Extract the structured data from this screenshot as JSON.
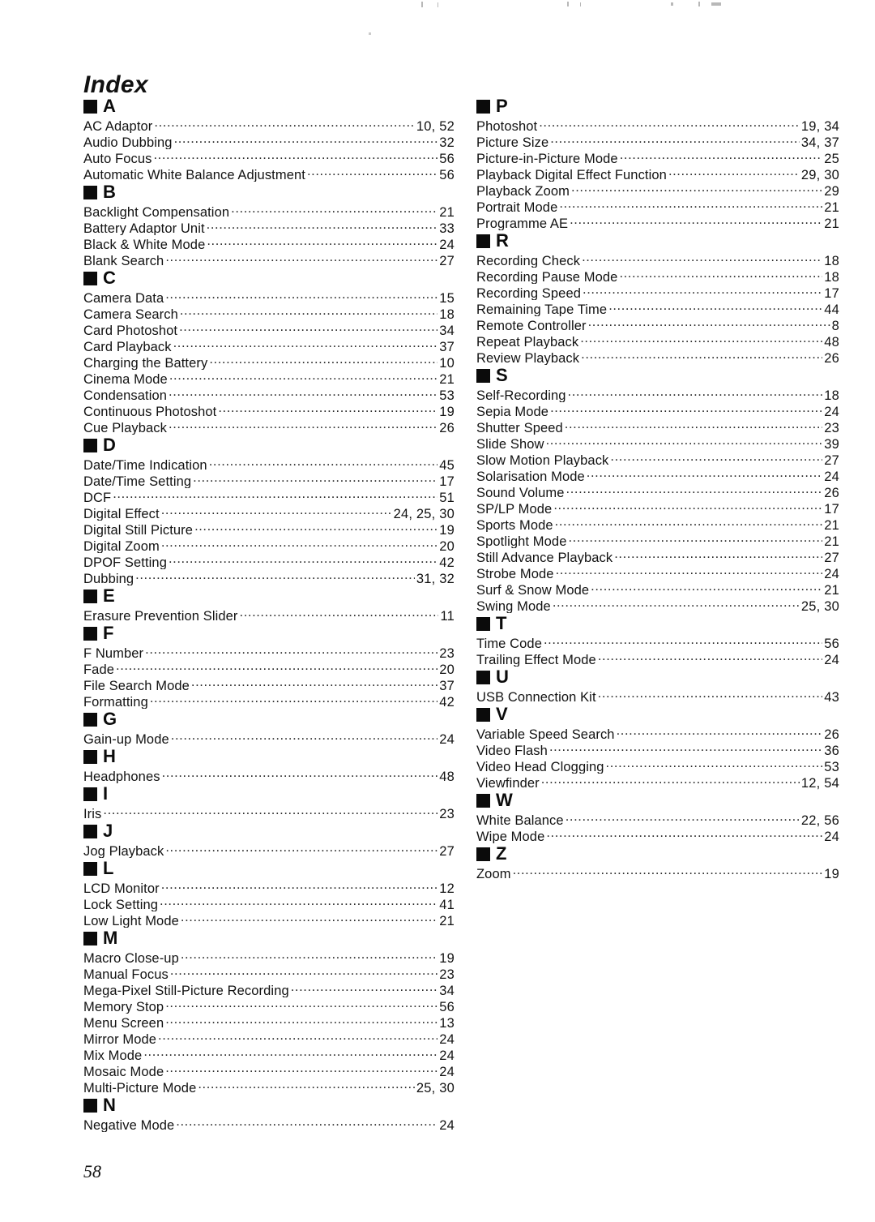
{
  "document": {
    "title": "Index",
    "page_number": "58"
  },
  "columns": [
    {
      "id": "left",
      "sections": [
        {
          "letter": "A",
          "entries": [
            {
              "term": "AC Adaptor",
              "pages": "10, 52"
            },
            {
              "term": "Audio Dubbing",
              "pages": "32"
            },
            {
              "term": "Auto Focus",
              "pages": "56"
            },
            {
              "term": "Automatic White Balance Adjustment",
              "pages": "56"
            }
          ]
        },
        {
          "letter": "B",
          "entries": [
            {
              "term": "Backlight Compensation",
              "pages": "21"
            },
            {
              "term": "Battery Adaptor Unit",
              "pages": "33"
            },
            {
              "term": "Black & White Mode",
              "pages": "24"
            },
            {
              "term": "Blank Search",
              "pages": "27"
            }
          ]
        },
        {
          "letter": "C",
          "entries": [
            {
              "term": "Camera Data",
              "pages": "15"
            },
            {
              "term": "Camera Search",
              "pages": "18"
            },
            {
              "term": "Card Photoshot",
              "pages": "34"
            },
            {
              "term": "Card Playback",
              "pages": "37"
            },
            {
              "term": "Charging the Battery",
              "pages": "10"
            },
            {
              "term": "Cinema Mode",
              "pages": "21"
            },
            {
              "term": "Condensation",
              "pages": "53"
            },
            {
              "term": "Continuous Photoshot",
              "pages": "19"
            },
            {
              "term": "Cue Playback",
              "pages": "26"
            }
          ]
        },
        {
          "letter": "D",
          "entries": [
            {
              "term": "Date/Time Indication",
              "pages": "45"
            },
            {
              "term": "Date/Time Setting",
              "pages": "17"
            },
            {
              "term": "DCF",
              "pages": "51"
            },
            {
              "term": "Digital Effect",
              "pages": "24, 25, 30"
            },
            {
              "term": "Digital Still Picture",
              "pages": "19"
            },
            {
              "term": "Digital Zoom",
              "pages": "20"
            },
            {
              "term": "DPOF Setting",
              "pages": "42"
            },
            {
              "term": "Dubbing",
              "pages": "31, 32"
            }
          ]
        },
        {
          "letter": "E",
          "entries": [
            {
              "term": "Erasure Prevention Slider",
              "pages": "11"
            }
          ]
        },
        {
          "letter": "F",
          "entries": [
            {
              "term": "F Number",
              "pages": "23"
            },
            {
              "term": "Fade",
              "pages": "20"
            },
            {
              "term": "File Search Mode",
              "pages": "37"
            },
            {
              "term": "Formatting",
              "pages": "42"
            }
          ]
        },
        {
          "letter": "G",
          "entries": [
            {
              "term": "Gain-up Mode",
              "pages": "24"
            }
          ]
        },
        {
          "letter": "H",
          "entries": [
            {
              "term": "Headphones",
              "pages": "48"
            }
          ]
        },
        {
          "letter": "I",
          "entries": [
            {
              "term": "Iris",
              "pages": "23"
            }
          ]
        },
        {
          "letter": "J",
          "entries": [
            {
              "term": "Jog Playback",
              "pages": "27"
            }
          ]
        },
        {
          "letter": "L",
          "entries": [
            {
              "term": "LCD Monitor",
              "pages": "12"
            },
            {
              "term": "Lock Setting",
              "pages": "41"
            },
            {
              "term": "Low Light Mode",
              "pages": "21"
            }
          ]
        },
        {
          "letter": "M",
          "entries": [
            {
              "term": "Macro Close-up",
              "pages": "19"
            },
            {
              "term": "Manual Focus",
              "pages": "23"
            },
            {
              "term": "Mega-Pixel Still-Picture Recording",
              "pages": "34"
            },
            {
              "term": "Memory Stop",
              "pages": "56"
            },
            {
              "term": "Menu Screen",
              "pages": "13"
            },
            {
              "term": "Mirror Mode",
              "pages": "24"
            },
            {
              "term": "Mix Mode",
              "pages": "24"
            },
            {
              "term": "Mosaic Mode",
              "pages": "24"
            },
            {
              "term": "Multi-Picture Mode",
              "pages": "25, 30"
            }
          ]
        },
        {
          "letter": "N",
          "entries": [
            {
              "term": "Negative Mode",
              "pages": "24"
            }
          ]
        }
      ]
    },
    {
      "id": "right",
      "sections": [
        {
          "letter": "P",
          "entries": [
            {
              "term": "Photoshot",
              "pages": "19, 34"
            },
            {
              "term": "Picture Size",
              "pages": "34, 37"
            },
            {
              "term": "Picture-in-Picture Mode",
              "pages": "25"
            },
            {
              "term": "Playback Digital Effect Function",
              "pages": "29, 30"
            },
            {
              "term": "Playback Zoom",
              "pages": "29"
            },
            {
              "term": "Portrait Mode",
              "pages": "21"
            },
            {
              "term": "Programme AE",
              "pages": "21"
            }
          ]
        },
        {
          "letter": "R",
          "entries": [
            {
              "term": "Recording Check",
              "pages": "18"
            },
            {
              "term": "Recording Pause Mode",
              "pages": "18"
            },
            {
              "term": "Recording Speed",
              "pages": "17"
            },
            {
              "term": "Remaining Tape Time",
              "pages": "44"
            },
            {
              "term": "Remote Controller",
              "pages": "8"
            },
            {
              "term": "Repeat Playback",
              "pages": "48"
            },
            {
              "term": "Review Playback",
              "pages": "26"
            }
          ]
        },
        {
          "letter": "S",
          "entries": [
            {
              "term": "Self-Recording",
              "pages": "18"
            },
            {
              "term": "Sepia Mode",
              "pages": "24"
            },
            {
              "term": "Shutter Speed",
              "pages": "23"
            },
            {
              "term": "Slide Show",
              "pages": "39"
            },
            {
              "term": "Slow Motion Playback",
              "pages": "27"
            },
            {
              "term": "Solarisation Mode",
              "pages": "24"
            },
            {
              "term": "Sound Volume",
              "pages": "26"
            },
            {
              "term": "SP/LP Mode",
              "pages": "17"
            },
            {
              "term": "Sports Mode",
              "pages": "21"
            },
            {
              "term": "Spotlight Mode",
              "pages": "21"
            },
            {
              "term": "Still Advance Playback",
              "pages": "27"
            },
            {
              "term": "Strobe Mode",
              "pages": "24"
            },
            {
              "term": "Surf & Snow Mode",
              "pages": "21"
            },
            {
              "term": "Swing Mode",
              "pages": "25, 30"
            }
          ]
        },
        {
          "letter": "T",
          "entries": [
            {
              "term": "Time Code",
              "pages": "56"
            },
            {
              "term": "Trailing Effect Mode",
              "pages": "24"
            }
          ]
        },
        {
          "letter": "U",
          "entries": [
            {
              "term": "USB Connection Kit",
              "pages": "43"
            }
          ]
        },
        {
          "letter": "V",
          "entries": [
            {
              "term": "Variable Speed Search",
              "pages": "26"
            },
            {
              "term": "Video Flash",
              "pages": "36"
            },
            {
              "term": "Video Head Clogging",
              "pages": "53"
            },
            {
              "term": "Viewfinder",
              "pages": "12, 54"
            }
          ]
        },
        {
          "letter": "W",
          "entries": [
            {
              "term": "White Balance",
              "pages": "22, 56"
            },
            {
              "term": "Wipe Mode",
              "pages": "24"
            }
          ]
        },
        {
          "letter": "Z",
          "entries": [
            {
              "term": "Zoom",
              "pages": "19"
            }
          ]
        }
      ]
    }
  ]
}
